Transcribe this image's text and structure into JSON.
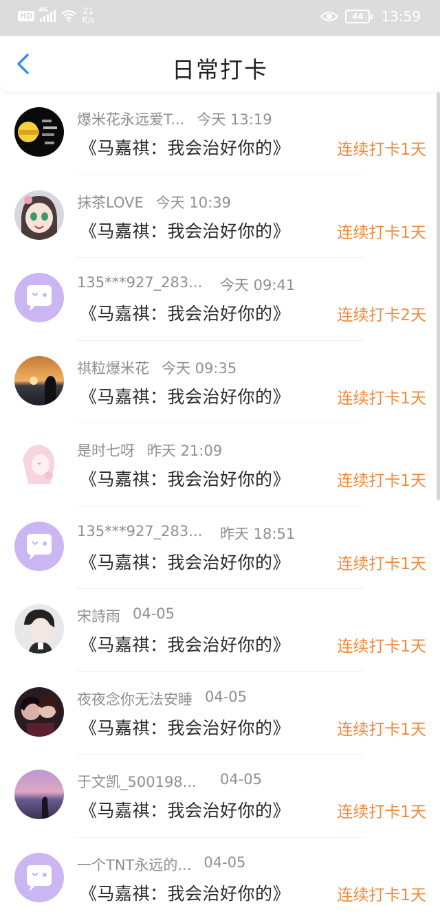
{
  "status_bar": {
    "hd": "HD",
    "network": "4G",
    "speed_value": "21",
    "speed_unit": "K/s",
    "battery": "44",
    "time": "13:59"
  },
  "header": {
    "title": "日常打卡"
  },
  "colors": {
    "accent": "#f08a3c",
    "back_arrow": "#2f8ff5",
    "default_avatar_bg": "#c9b6f2"
  },
  "entries": [
    {
      "name": "爆米花永远爱T...",
      "time": "今天 13:19",
      "book": "《马嘉祺：我会治好你的》",
      "streak": "连续打卡1天",
      "avatar": "photo-dark-card"
    },
    {
      "name": "抹茶LOVE",
      "time": "今天 10:39",
      "book": "《马嘉祺：我会治好你的》",
      "streak": "连续打卡1天",
      "avatar": "anime-girl"
    },
    {
      "name": "135***927_283...",
      "time": "今天 09:41",
      "book": "《马嘉祺：我会治好你的》",
      "streak": "连续打卡2天",
      "avatar": "default-chat-bubble"
    },
    {
      "name": "祺粒爆米花",
      "time": "今天 09:35",
      "book": "《马嘉祺：我会治好你的》",
      "streak": "连续打卡1天",
      "avatar": "sunset-silhouette"
    },
    {
      "name": "是时七呀",
      "time": "昨天 21:09",
      "book": "《马嘉祺：我会治好你的》",
      "streak": "连续打卡1天",
      "avatar": "pink-anime"
    },
    {
      "name": "135***927_283...",
      "time": "昨天 18:51",
      "book": "《马嘉祺：我会治好你的》",
      "streak": "连续打卡1天",
      "avatar": "default-chat-bubble"
    },
    {
      "name": "宋詩雨",
      "time": "04-05",
      "book": "《马嘉祺：我会治好你的》",
      "streak": "连续打卡1天",
      "avatar": "boy-portrait"
    },
    {
      "name": "夜夜念你无法安睡",
      "time": "04-05",
      "book": "《马嘉祺：我会治好你的》",
      "streak": "连续打卡1天",
      "avatar": "couple-photo"
    },
    {
      "name": "于文凯_500198...",
      "time": "04-05",
      "book": "《马嘉祺：我会治好你的》",
      "streak": "连续打卡1天",
      "avatar": "purple-beach"
    },
    {
      "name": "一个TNT永远的...",
      "time": "04-05",
      "book": "《马嘉祺：我会治好你的》",
      "streak": "连续打卡1天",
      "avatar": "default-chat-bubble"
    }
  ]
}
